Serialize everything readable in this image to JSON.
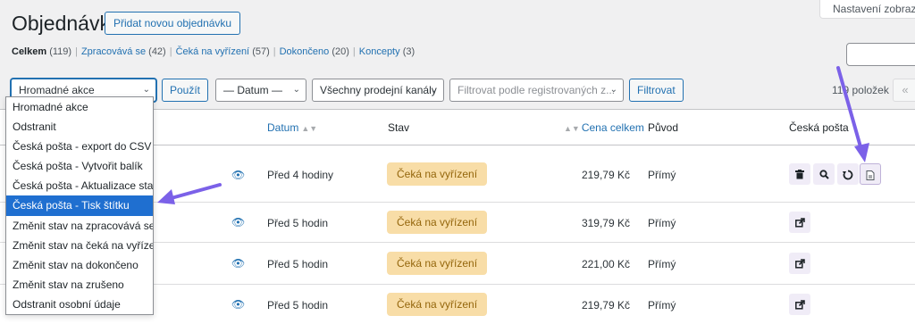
{
  "header": {
    "title": "Objednávky",
    "add_new_label": "Přidat novou objednávku",
    "screen_options_label": "Nastavení zobrazení"
  },
  "views": [
    {
      "label": "Celkem",
      "count": "(119)",
      "current": true
    },
    {
      "label": "Zpracovává se",
      "count": "(42)"
    },
    {
      "label": "Čeká na vyřízení",
      "count": "(57)"
    },
    {
      "label": "Dokončeno",
      "count": "(20)"
    },
    {
      "label": "Koncepty",
      "count": "(3)"
    }
  ],
  "toolbar": {
    "bulk_select_value": "Hromadné akce",
    "apply_label": "Použít",
    "date_select_value": "— Datum —",
    "channel_select_value": "Všechny prodejní kanály",
    "customer_filter_placeholder": "Filtrovat podle registrovaných z...",
    "filter_label": "Filtrovat",
    "items_count": "119 položek",
    "prev_page_glyph": "«"
  },
  "bulk_actions_dropdown": {
    "options": [
      "Hromadné akce",
      "Odstranit",
      "Česká pošta - export do CSV",
      "Česká pošta - Vytvořit balík",
      "Česká pošta - Aktualizace stavu",
      "Česká pošta - Tisk štítku",
      "Změnit stav na zpracovává se",
      "Změnit stav na čeká na vyřízení",
      "Změnit stav na dokončeno",
      "Změnit stav na zrušeno",
      "Odstranit osobní údaje"
    ],
    "selected_index": 5
  },
  "table": {
    "columns": {
      "date": "Datum",
      "status": "Stav",
      "total": "Cena celkem",
      "origin": "Původ",
      "ceska_posta": "Česká pošta"
    },
    "rows": [
      {
        "date": "Před 4 hodiny",
        "status": "Čeká na vyřízení",
        "total": "219,79 Kč",
        "origin": "Přímý",
        "actions": [
          "trash-icon",
          "search-icon",
          "refresh-icon",
          "label-print-icon"
        ]
      },
      {
        "date": "Před 5 hodin",
        "status": "Čeká na vyřízení",
        "total": "319,79 Kč",
        "origin": "Přímý",
        "actions": [
          "external-link-icon"
        ]
      },
      {
        "date": "Před 5 hodin",
        "status": "Čeká na vyřízení",
        "total": "221,00 Kč",
        "origin": "Přímý",
        "actions": [
          "external-link-icon"
        ]
      },
      {
        "date": "Před 5 hodin",
        "status": "Čeká na vyřízení",
        "total": "219,79 Kč",
        "origin": "Přímý",
        "actions": [
          "external-link-icon"
        ]
      }
    ]
  },
  "colors": {
    "accent": "#2271b1",
    "status_pending_bg": "#f8dda7",
    "status_pending_text": "#94660c",
    "dropdown_selected": "#1f6fd0",
    "annotation_arrow": "#7b61e8"
  }
}
